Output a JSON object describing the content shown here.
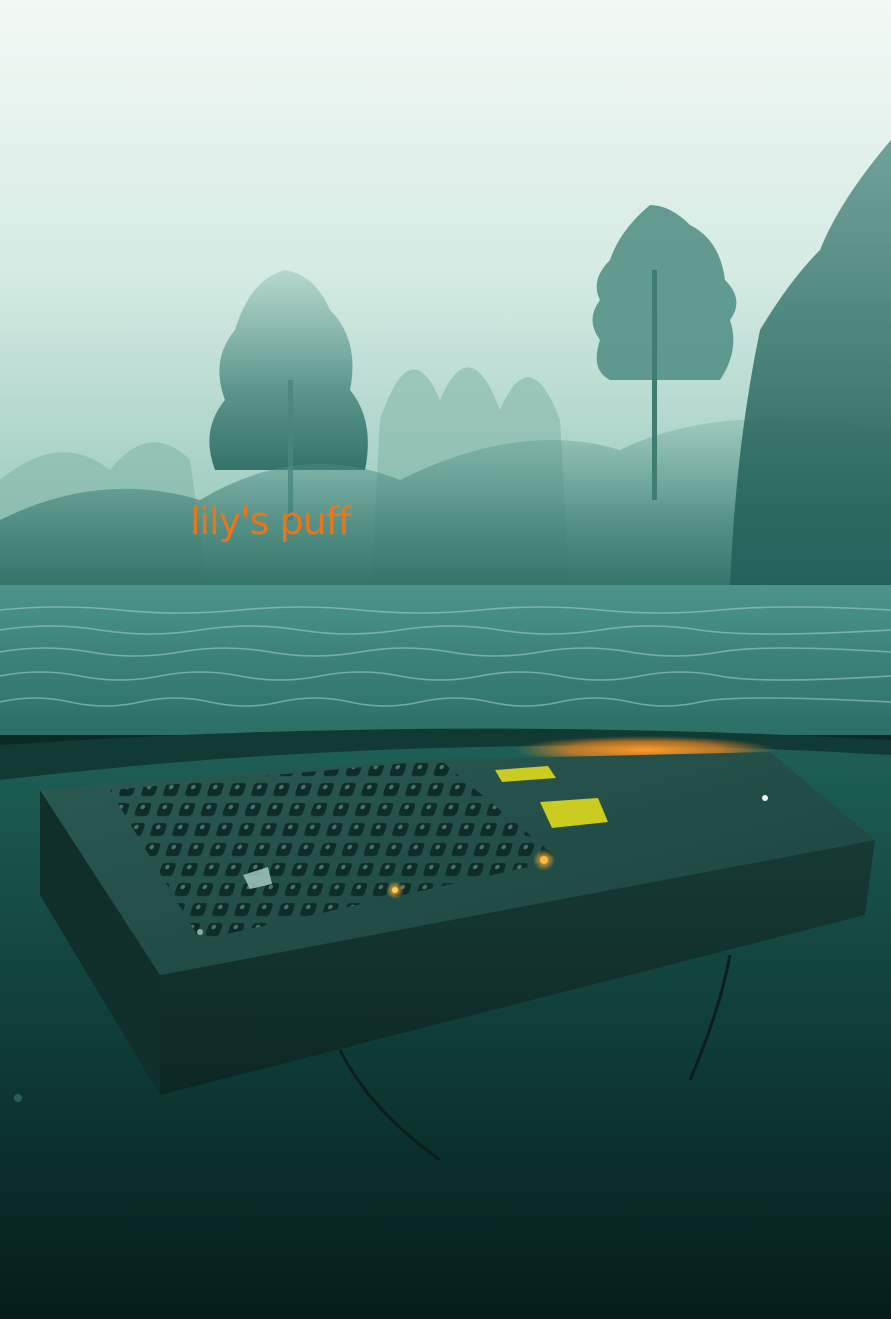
{
  "caption": {
    "text": "lily's puff",
    "color": "#e8761c"
  },
  "palette": {
    "sky_top": "#f1f8f3",
    "fog_mid": "#a9d3c6",
    "tree_line": "#2f6f66",
    "water_surface": "#3f8a82",
    "underwater_top": "#1a5a52",
    "underwater_bottom": "#062320",
    "device_body": "#153934",
    "glow_orange": "#f0841e",
    "glow_yellow": "#e7e21a"
  }
}
